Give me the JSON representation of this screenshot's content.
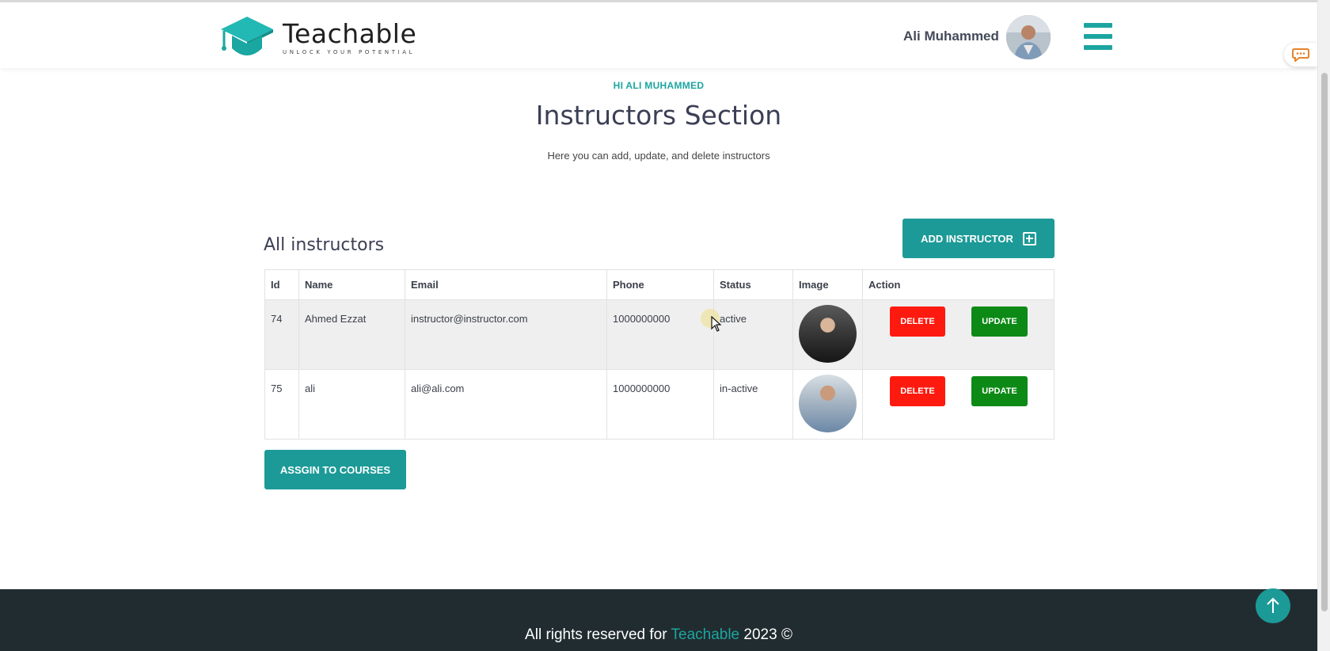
{
  "header": {
    "brand_name": "Teachable",
    "brand_tagline": "UNLOCK YOUR POTENTIAL",
    "user_name": "Ali Muhammed",
    "accent_color": "#1ca5a0"
  },
  "hero": {
    "greeting": "HI ALI MUHAMMED",
    "title": "Instructors Section",
    "subtitle": "Here you can add, update, and delete instructors"
  },
  "section": {
    "title": "All instructors",
    "add_button_label": "ADD INSTRUCTOR",
    "assign_button_label": "ASSGIN TO COURSES"
  },
  "table": {
    "columns": [
      "Id",
      "Name",
      "Email",
      "Phone",
      "Status",
      "Image",
      "Action"
    ],
    "rows": [
      {
        "id": "74",
        "name": "Ahmed Ezzat",
        "email": "instructor@instructor.com",
        "phone": "1000000000",
        "status": "active",
        "delete_label": "DELETE",
        "update_label": "UPDATE"
      },
      {
        "id": "75",
        "name": "ali",
        "email": "ali@ali.com",
        "phone": "1000000000",
        "status": "in-active",
        "delete_label": "DELETE",
        "update_label": "UPDATE"
      }
    ]
  },
  "footer": {
    "text_before": "All rights reserved for ",
    "brand": "Teachable",
    "text_after": " 2023 ©"
  },
  "icons": [
    "graduation-cap-logo-icon",
    "hamburger-menu-icon",
    "chat-icon",
    "plus-square-icon",
    "arrow-up-icon",
    "mouse-cursor-icon"
  ],
  "colors": {
    "teal": "#1c9a97",
    "delete": "#ff1a0f",
    "update": "#0d8a16",
    "footer_bg": "#212c30"
  }
}
